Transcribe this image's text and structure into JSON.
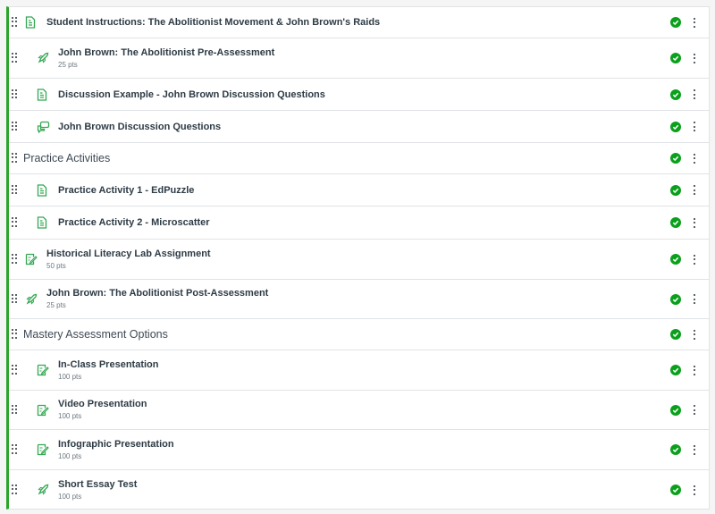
{
  "colors": {
    "accent_border": "#2ba52b",
    "published": "#0ba01c",
    "icon": "#34a853"
  },
  "items": [
    {
      "type": "page",
      "icon": "document-icon",
      "indent": 0,
      "title": "Student Instructions: The Abolitionist Movement & John Brown's Raids",
      "points": null,
      "published": true
    },
    {
      "type": "quiz",
      "icon": "rocket-icon",
      "indent": 1,
      "title": "John Brown: The Abolitionist Pre-Assessment",
      "points": "25 pts",
      "published": true
    },
    {
      "type": "page",
      "icon": "document-icon",
      "indent": 1,
      "title": "Discussion Example - John Brown Discussion Questions",
      "points": null,
      "published": true
    },
    {
      "type": "discussion",
      "icon": "discussion-icon",
      "indent": 1,
      "title": "John Brown Discussion Questions",
      "points": null,
      "published": true
    },
    {
      "type": "header",
      "icon": null,
      "indent": 0,
      "title": "Practice Activities",
      "points": null,
      "published": true
    },
    {
      "type": "page",
      "icon": "document-icon",
      "indent": 1,
      "title": "Practice Activity 1 - EdPuzzle",
      "points": null,
      "published": true
    },
    {
      "type": "page",
      "icon": "document-icon",
      "indent": 1,
      "title": "Practice Activity 2 - Microscatter",
      "points": null,
      "published": true
    },
    {
      "type": "assignment",
      "icon": "assignment-icon",
      "indent": 0,
      "title": "Historical Literacy Lab Assignment",
      "points": "50 pts",
      "published": true
    },
    {
      "type": "quiz",
      "icon": "rocket-icon",
      "indent": 0,
      "title": "John Brown: The Abolitionist Post-Assessment",
      "points": "25 pts",
      "published": true
    },
    {
      "type": "header",
      "icon": null,
      "indent": 0,
      "title": "Mastery Assessment Options",
      "points": null,
      "published": true
    },
    {
      "type": "assignment",
      "icon": "assignment-icon",
      "indent": 1,
      "title": "In-Class Presentation",
      "points": "100 pts",
      "published": true
    },
    {
      "type": "assignment",
      "icon": "assignment-icon",
      "indent": 1,
      "title": "Video Presentation",
      "points": "100 pts",
      "published": true
    },
    {
      "type": "assignment",
      "icon": "assignment-icon",
      "indent": 1,
      "title": "Infographic Presentation",
      "points": "100 pts",
      "published": true
    },
    {
      "type": "quiz",
      "icon": "rocket-icon",
      "indent": 1,
      "title": "Short Essay Test",
      "points": "100 pts",
      "published": true
    }
  ]
}
